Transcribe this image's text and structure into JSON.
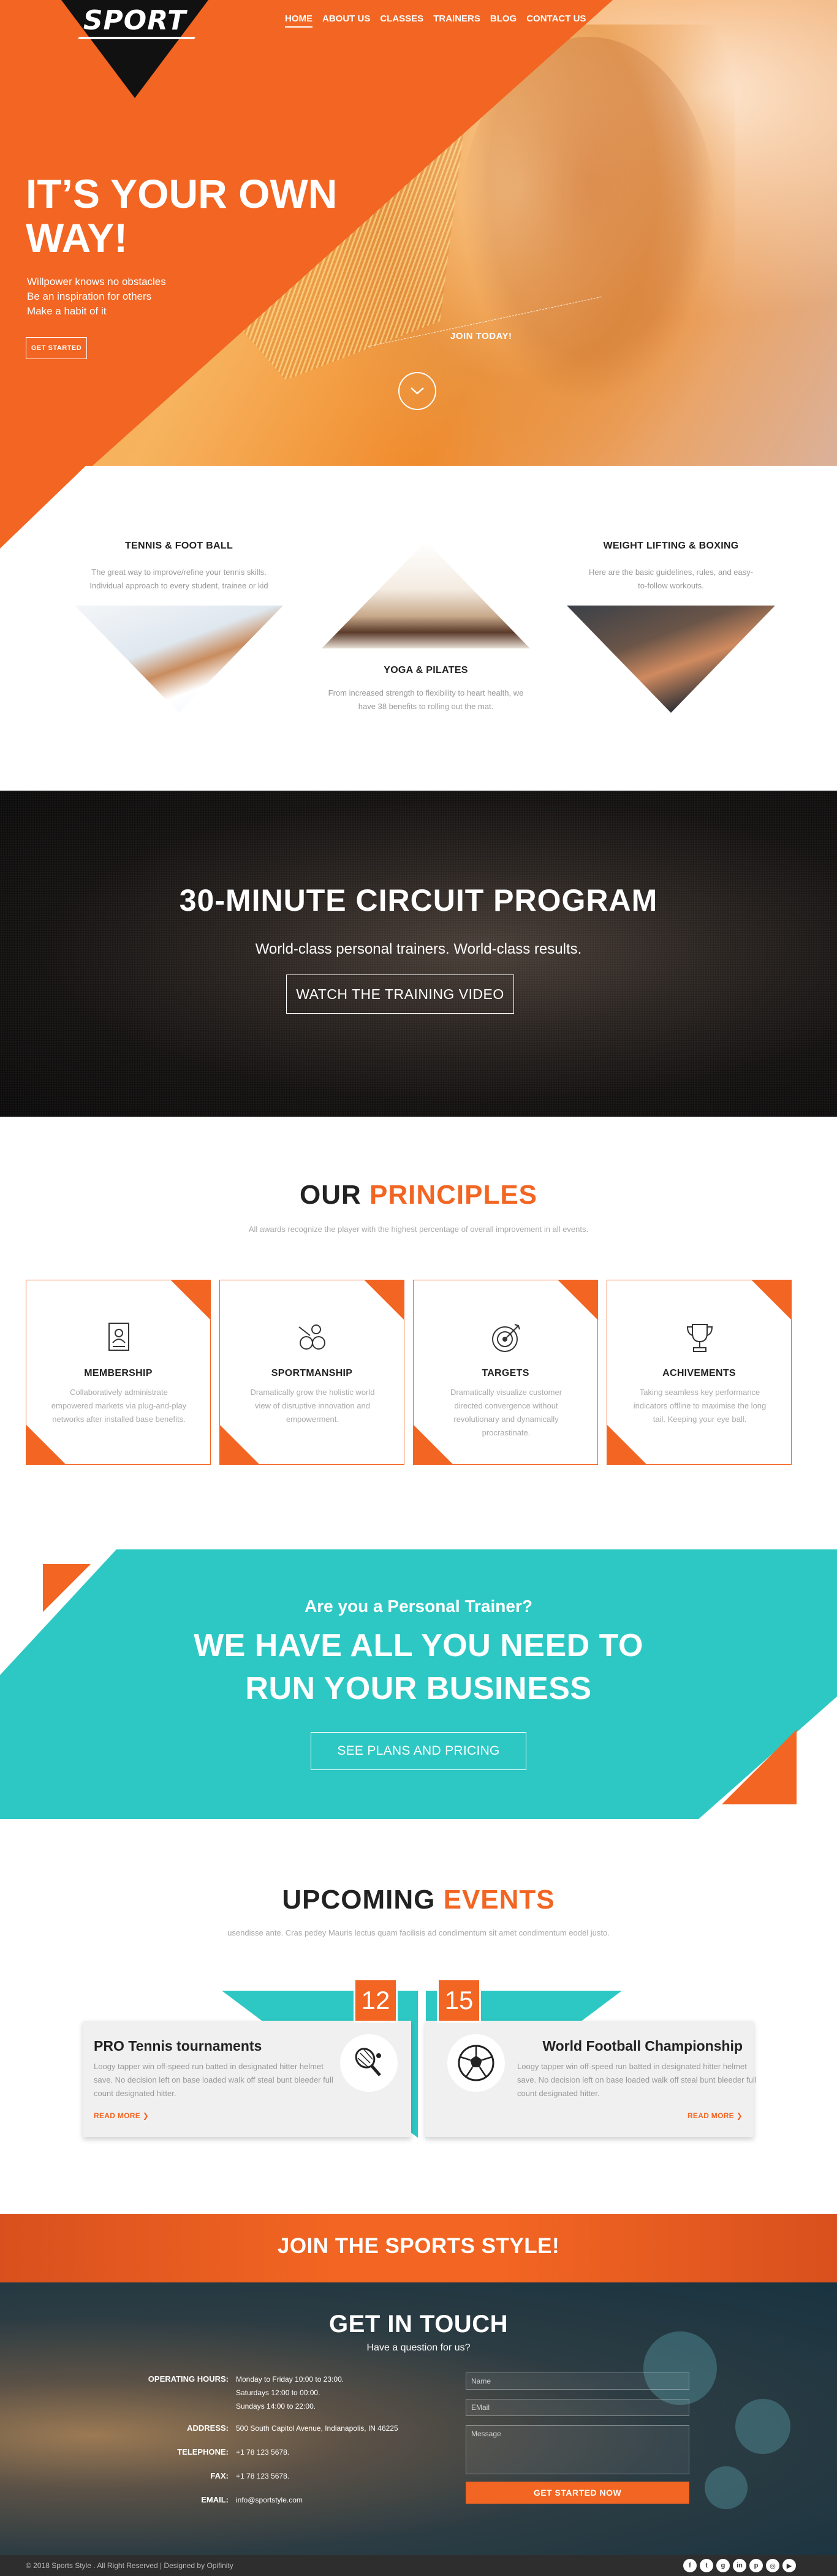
{
  "brand": {
    "logo": "SPORT"
  },
  "nav": {
    "items": [
      "HOME",
      "ABOUT US",
      "CLASSES",
      "TRAINERS",
      "BLOG",
      "CONTACT US"
    ],
    "active": "HOME"
  },
  "hero": {
    "title": "IT’S YOUR OWN WAY!",
    "lines": [
      "Willpower knows no obstacles",
      "Be an inspiration for others",
      "Make a habit of it"
    ],
    "cta": "GET STARTED",
    "join": "JOIN TODAY!",
    "scroll_icon": "chevron-down-icon"
  },
  "activities": [
    {
      "title": "TENNIS & FOOT BALL",
      "desc": "The great way to improve/refine your tennis skills. Individual approach to every student, trainee or kid"
    },
    {
      "title": "YOGA & PILATES",
      "desc": "From increased strength to flexibility to heart health, we have 38 benefits to rolling out the mat."
    },
    {
      "title": "WEIGHT LIFTING & BOXING",
      "desc": "Here are the basic guidelines, rules, and easy-to-follow workouts."
    }
  ],
  "circuit": {
    "title": "30-MINUTE CIRCUIT PROGRAM",
    "subtitle": "World-class personal trainers. World-class results.",
    "button": "WATCH THE TRAINING VIDEO"
  },
  "principles": {
    "title_a": "OUR ",
    "title_b": "PRINCIPLES",
    "subtitle": "All awards recognize the player with the highest percentage of overall improvement in all events.",
    "cards": [
      {
        "title": "MEMBERSHIP",
        "icon": "membership-card-icon",
        "desc": "Collaboratively administrate empowered markets via plug-and-play networks after installed base benefits."
      },
      {
        "title": "SPORTMANSHIP",
        "icon": "sports-equipment-icon",
        "desc": "Dramatically grow the holistic world view of disruptive innovation and empowerment."
      },
      {
        "title": "TARGETS",
        "icon": "target-icon",
        "desc": "Dramatically visualize customer directed convergence without revolutionary and dynamically procrastinate."
      },
      {
        "title": "ACHIVEMENTS",
        "icon": "trophy-icon",
        "desc": "Taking seamless key performance indicators offline to maximise the long tail. Keeping your eye ball."
      }
    ]
  },
  "trainer": {
    "question": "Are you a Personal Trainer?",
    "title": "WE HAVE ALL YOU NEED TO RUN YOUR BUSINESS",
    "button": "SEE PLANS AND PRICING"
  },
  "events": {
    "title_a": "UPCOMING ",
    "title_b": "EVENTS",
    "subtitle": "usendisse ante. Cras pedey Mauris lectus quam facilisis ad condimentum sit amet condimentum eodel justo.",
    "items": [
      {
        "date": "12",
        "title": "PRO Tennis  tournaments",
        "icon": "tennis-racket-icon",
        "desc": "Loogy tapper win off-speed run batted in designated hitter helmet save. No decision left on base loaded walk off steal bunt bleeder full count designated hitter.",
        "more": "READ MORE"
      },
      {
        "date": "15",
        "title": "World Football Championship",
        "icon": "soccer-ball-icon",
        "desc": "Loogy tapper win off-speed run batted in designated hitter helmet save. No decision left on base loaded walk off steal bunt bleeder full count designated hitter.",
        "more": "READ MORE"
      }
    ]
  },
  "join": {
    "text": "JOIN THE SPORTS STYLE!"
  },
  "contact": {
    "title": "GET IN TOUCH",
    "subtitle": "Have a question for us?",
    "hours_label": "OPERATING HOURS:",
    "hours": [
      "Monday to Friday 10:00 to 23:00.",
      "Saturdays 12:00 to 00:00.",
      "Sundays 14:00 to 22:00."
    ],
    "address_label": "ADDRESS:",
    "address": "500 South Capitol Avenue, Indianapolis, IN 46225",
    "telephone_label": "TELEPHONE:",
    "telephone": "+1 78 123 5678.",
    "fax_label": "FAX:",
    "fax": "+1 78 123 5678.",
    "email_label": "EMAIL:",
    "email": "info@sportstyle.com",
    "form": {
      "name_placeholder": "Name",
      "email_placeholder": "EMail",
      "message_placeholder": "Message",
      "submit": "GET STARTED NOW"
    }
  },
  "footer": {
    "text": "© 2018 Sports Style . All Right Reserved | Designed by Opifinity",
    "socials": [
      "facebook-icon",
      "twitter-icon",
      "google-plus-icon",
      "linkedin-icon",
      "pinterest-icon",
      "instagram-icon",
      "youtube-icon"
    ]
  },
  "colors": {
    "accent": "#f26522",
    "teal": "#2dc8c4",
    "dark": "#2e2e2e"
  }
}
